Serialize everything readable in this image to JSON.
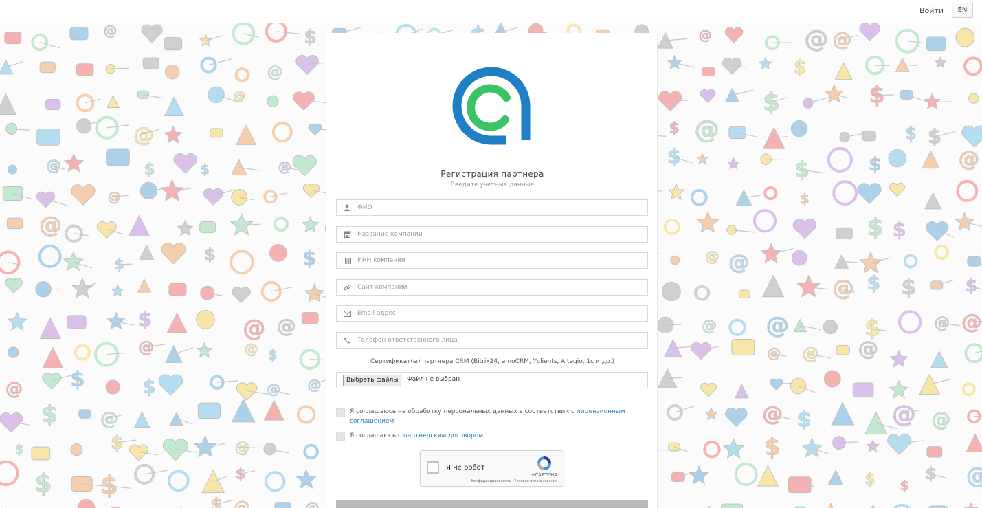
{
  "header": {
    "login_label": "Войти",
    "lang_label": "EN"
  },
  "form": {
    "title": "Регистрация партнера",
    "subtitle": "Введите учетные данные",
    "fields": [
      {
        "placeholder": "ФИО",
        "icon": "user-icon"
      },
      {
        "placeholder": "Название компании",
        "icon": "store-icon"
      },
      {
        "placeholder": "ИНН компании",
        "icon": "barcode-icon"
      },
      {
        "placeholder": "Сайт компании",
        "icon": "link-icon"
      },
      {
        "placeholder": "Email адрес",
        "icon": "envelope-icon"
      },
      {
        "placeholder": "Телефон ответственного лица",
        "icon": "phone-icon"
      }
    ],
    "cert_label": "Сертификат(ы) партнера CRM (Bitrix24, amoCRM, Yclients, Altegio, 1c и др.)",
    "file_button": "Выбрать файлы",
    "file_status": "Файл не выбран",
    "agree1_text": "Я соглашаюсь на обработку персональных данных в соответствии с ",
    "agree1_link": "лицензионным соглашением",
    "agree2_text": "Я соглашаюсь с ",
    "agree2_link": "партнерским договором"
  },
  "recaptcha": {
    "label": "Я не робот",
    "brand": "reCAPTCHA",
    "links": "Конфиденциальность - Условия использования"
  },
  "colors": {
    "logo_blue": "#1e7fc4",
    "logo_green": "#3cc36a",
    "link": "#2a7fc1",
    "submit_bg": "#b9b9b9"
  }
}
